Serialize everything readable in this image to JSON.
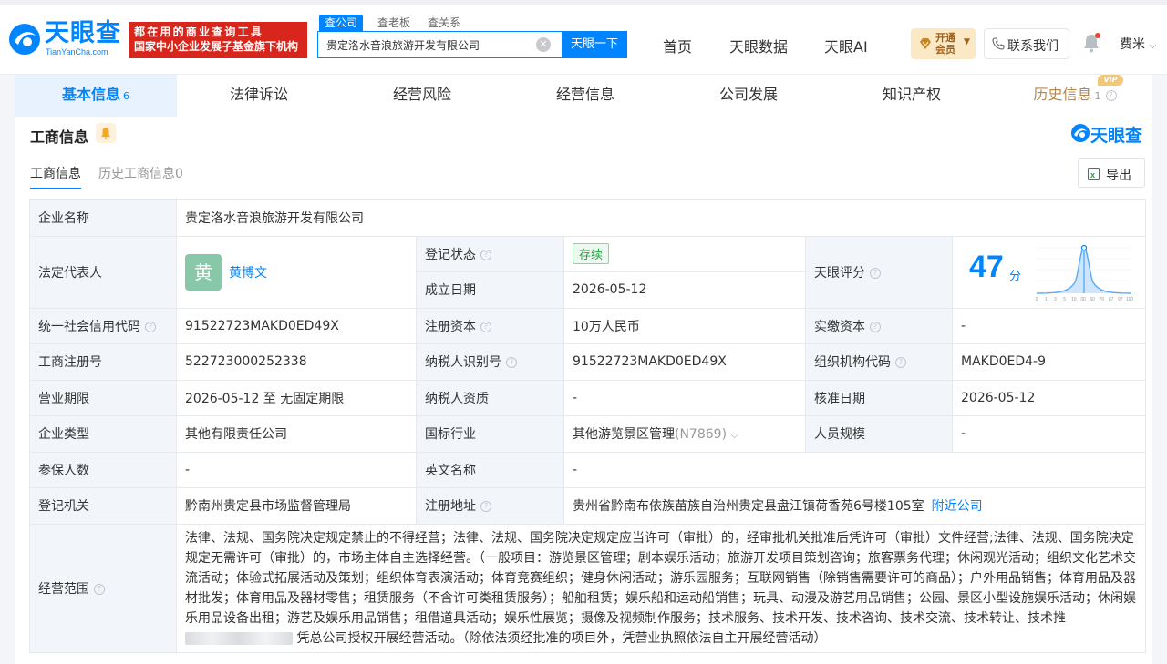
{
  "brand": {
    "name": "天眼查",
    "domain": "TianYanCha.com",
    "slogan_line1": "都在用的商业查询工具",
    "slogan_line2": "国家中小企业发展子基金旗下机构",
    "mark": "天眼查",
    "color": "#0084ff"
  },
  "search": {
    "tabs": [
      "查公司",
      "查老板",
      "查关系"
    ],
    "value": "贵定洛水音浪旅游开发有限公司",
    "button": "天眼一下"
  },
  "nav": {
    "links": [
      "首页",
      "天眼数据",
      "天眼AI"
    ],
    "vip_line1": "开通",
    "vip_line2": "会员",
    "contact": "联系我们",
    "user": "费米"
  },
  "main_tabs": [
    {
      "label": "基本信息",
      "count": "6"
    },
    {
      "label": "法律诉讼"
    },
    {
      "label": "经营风险"
    },
    {
      "label": "经营信息"
    },
    {
      "label": "公司发展"
    },
    {
      "label": "知识产权"
    },
    {
      "label": "历史信息",
      "count": "1",
      "badge": "VIP"
    }
  ],
  "section": {
    "title": "工商信息",
    "subtabs": [
      "工商信息",
      "历史工商信息0"
    ],
    "export": "导出"
  },
  "info": {
    "company_name_label": "企业名称",
    "company_name": "贵定洛水音浪旅游开发有限公司",
    "legal_rep_label": "法定代表人",
    "legal_rep_avatar": "黄",
    "legal_rep": "黄博文",
    "reg_status_label": "登记状态",
    "reg_status": "存续",
    "found_date_label": "成立日期",
    "found_date": "2026-05-12",
    "score_label": "天眼评分",
    "score": "47",
    "score_unit": "分",
    "credit_code_label": "统一社会信用代码",
    "credit_code": "91522723MAKD0ED49X",
    "reg_capital_label": "注册资本",
    "reg_capital": "10万人民币",
    "paid_capital_label": "实缴资本",
    "paid_capital": "-",
    "reg_no_label": "工商注册号",
    "reg_no": "522723000252338",
    "taxpayer_id_label": "纳税人识别号",
    "taxpayer_id": "91522723MAKD0ED49X",
    "org_code_label": "组织机构代码",
    "org_code": "MAKD0ED4-9",
    "term_label": "营业期限",
    "term": "2026-05-12 至 无固定期限",
    "taxpayer_qual_label": "纳税人资质",
    "taxpayer_qual": "-",
    "approve_date_label": "核准日期",
    "approve_date": "2026-05-12",
    "type_label": "企业类型",
    "type": "其他有限责任公司",
    "industry_label": "国标行业",
    "industry": "其他游览景区管理",
    "industry_code": "(N7869)",
    "staff_label": "人员规模",
    "staff": "-",
    "insured_label": "参保人数",
    "insured": "-",
    "en_name_label": "英文名称",
    "en_name": "-",
    "authority_label": "登记机关",
    "authority": "黔南州贵定县市场监督管理局",
    "address_label": "注册地址",
    "address": "贵州省黔南布依族苗族自治州贵定县盘江镇荷香苑6号楼105室",
    "nearby": "附近公司",
    "scope_label": "经营范围",
    "scope": "法律、法规、国务院决定规定禁止的不得经营；法律、法规、国务院决定规定应当许可（审批）的，经审批机关批准后凭许可（审批）文件经营;法律、法规、国务院决定规定无需许可（审批）的，市场主体自主选择经营。（一般项目：游览景区管理；剧本娱乐活动；旅游开发项目策划咨询；旅客票务代理；休闲观光活动；组织文化艺术交流活动；体验式拓展活动及策划；组织体育表演活动；体育竞赛组织；健身休闲活动；游乐园服务；互联网销售（除销售需要许可的商品）；户外用品销售；体育用品及器材批发；体育用品及器材零售；租赁服务（不含许可类租赁服务）；船舶租赁；娱乐船和运动船销售；玩具、动漫及游艺用品销售；公园、景区小型设施娱乐活动；休闲娱乐用品设备出租；游艺及娱乐用品销售；租借道具活动；娱乐性展览；摄像及视频制作服务；技术服务、技术开发、技术咨询、技术交流、技术转让、技术推",
    "scope_tail": "凭总公司授权开展经营活动。（除依法须经批准的项目外，凭营业执照依法自主开展经营活动）"
  },
  "score_axis": [
    "0",
    "1",
    "3",
    "5",
    "10",
    "30",
    "50",
    "70",
    "87",
    "97",
    "100"
  ]
}
